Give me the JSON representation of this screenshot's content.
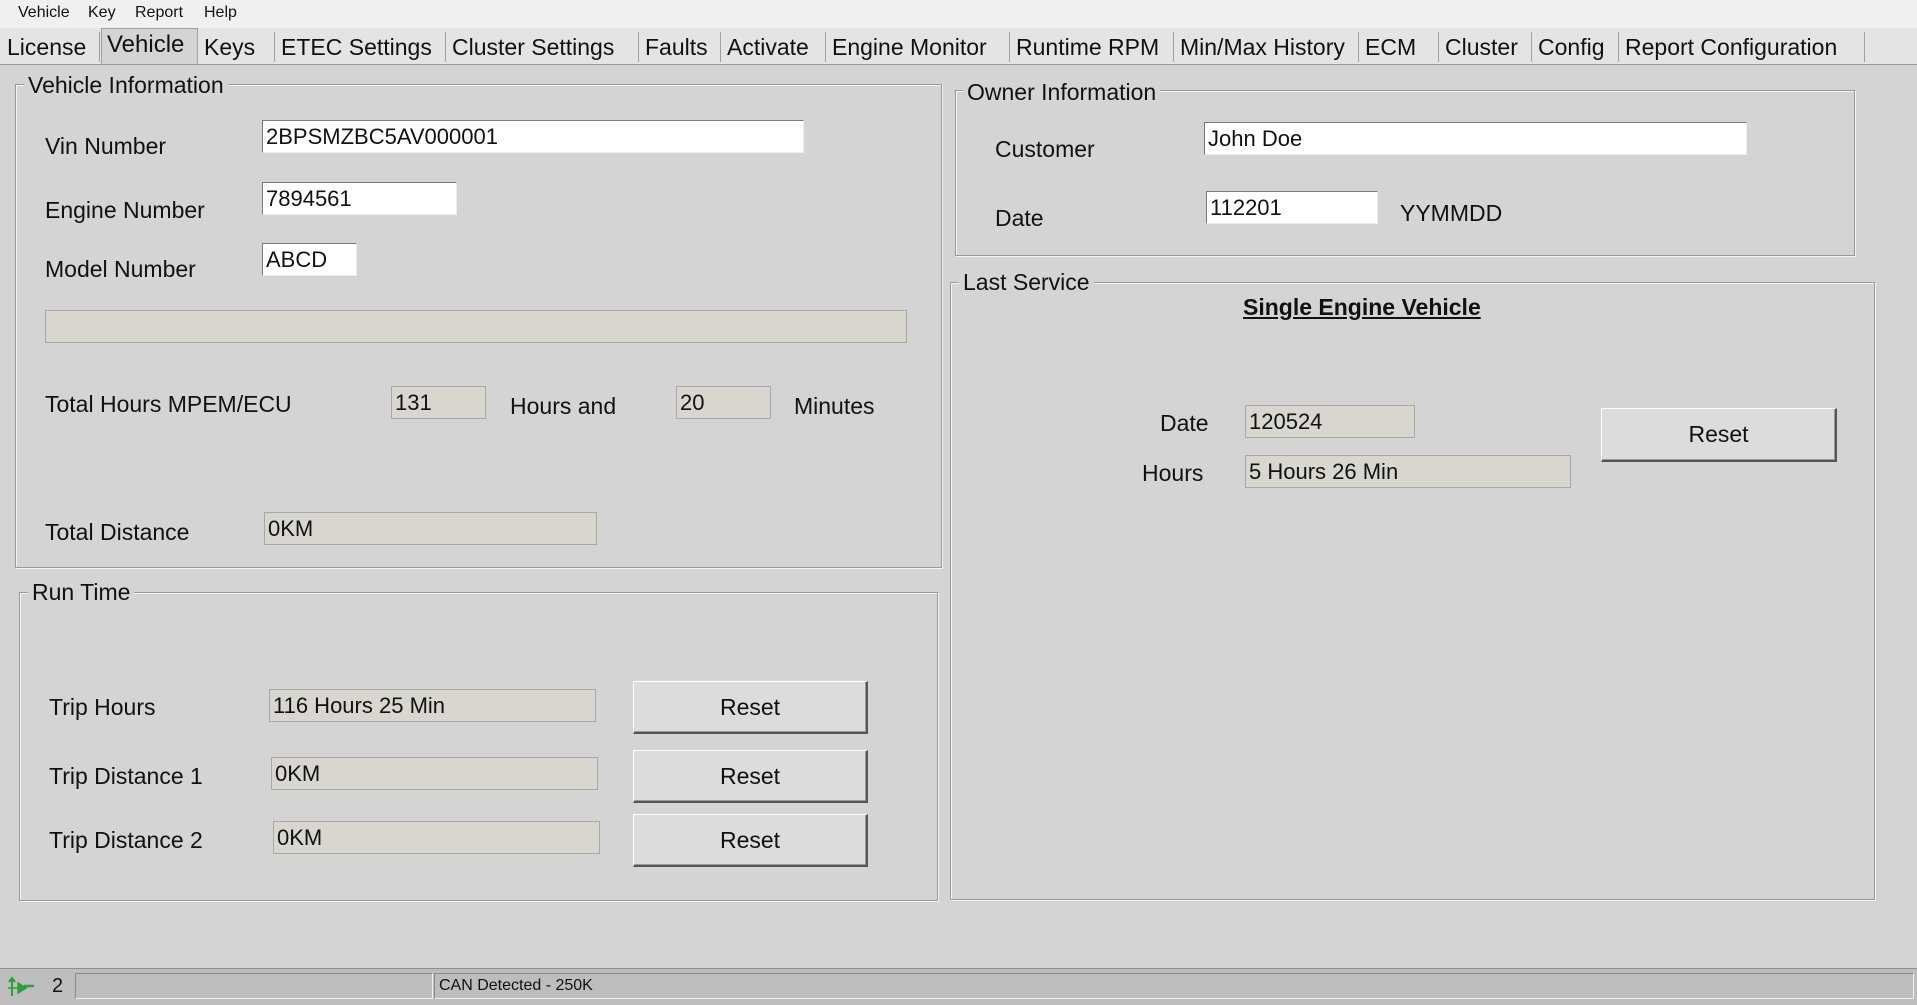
{
  "menu": [
    "Vehicle",
    "Key",
    "Report",
    "Help"
  ],
  "tabs": [
    "License",
    "Vehicle",
    "Keys",
    "ETEC Settings",
    "Cluster Settings",
    "Faults",
    "Activate",
    "Engine Monitor",
    "Runtime RPM",
    "Min/Max History",
    "ECM",
    "Cluster",
    "Config",
    "Report Configuration"
  ],
  "active_tab": "Vehicle",
  "vehicle_info": {
    "legend": "Vehicle Information",
    "vin_label": "Vin Number",
    "vin_value": "2BPSMZBC5AV000001",
    "engine_label": "Engine Number",
    "engine_value": "7894561",
    "model_label": "Model Number",
    "model_value": "ABCD",
    "blank_value": "",
    "total_hours_label": "Total Hours MPEM/ECU",
    "hours_value": "131",
    "hours_and_label": "Hours and",
    "minutes_value": "20",
    "minutes_label": "Minutes",
    "distance_label": "Total Distance",
    "distance_value": "0KM"
  },
  "run_time": {
    "legend": "Run Time",
    "trip_hours_label": "Trip Hours",
    "trip_hours_value": "116 Hours  25 Min",
    "trip_dist1_label": "Trip Distance 1",
    "trip_dist1_value": "0KM",
    "trip_dist2_label": "Trip Distance 2",
    "trip_dist2_value": "0KM",
    "reset_label": "Reset"
  },
  "owner_info": {
    "legend": "Owner Information",
    "customer_label": "Customer",
    "customer_value": "John Doe",
    "date_label": "Date",
    "date_value": "112201",
    "date_format": "YYMMDD"
  },
  "last_service": {
    "legend": "Last Service",
    "heading": "Single Engine Vehicle",
    "date_label": "Date",
    "date_value": "120524",
    "hours_label": "Hours",
    "hours_value": "5 Hours  26 Min",
    "reset_label": "Reset"
  },
  "status": {
    "number": "2",
    "progress_text": "",
    "message": "CAN Detected - 250K"
  },
  "colors": {
    "background": "#d4d4d4",
    "editable_field": "#ffffff",
    "readonly_field": "#d9d6d0",
    "status_icon": "#2e9e3a"
  },
  "icons": {
    "status_icon": "connection-arrows-icon"
  }
}
